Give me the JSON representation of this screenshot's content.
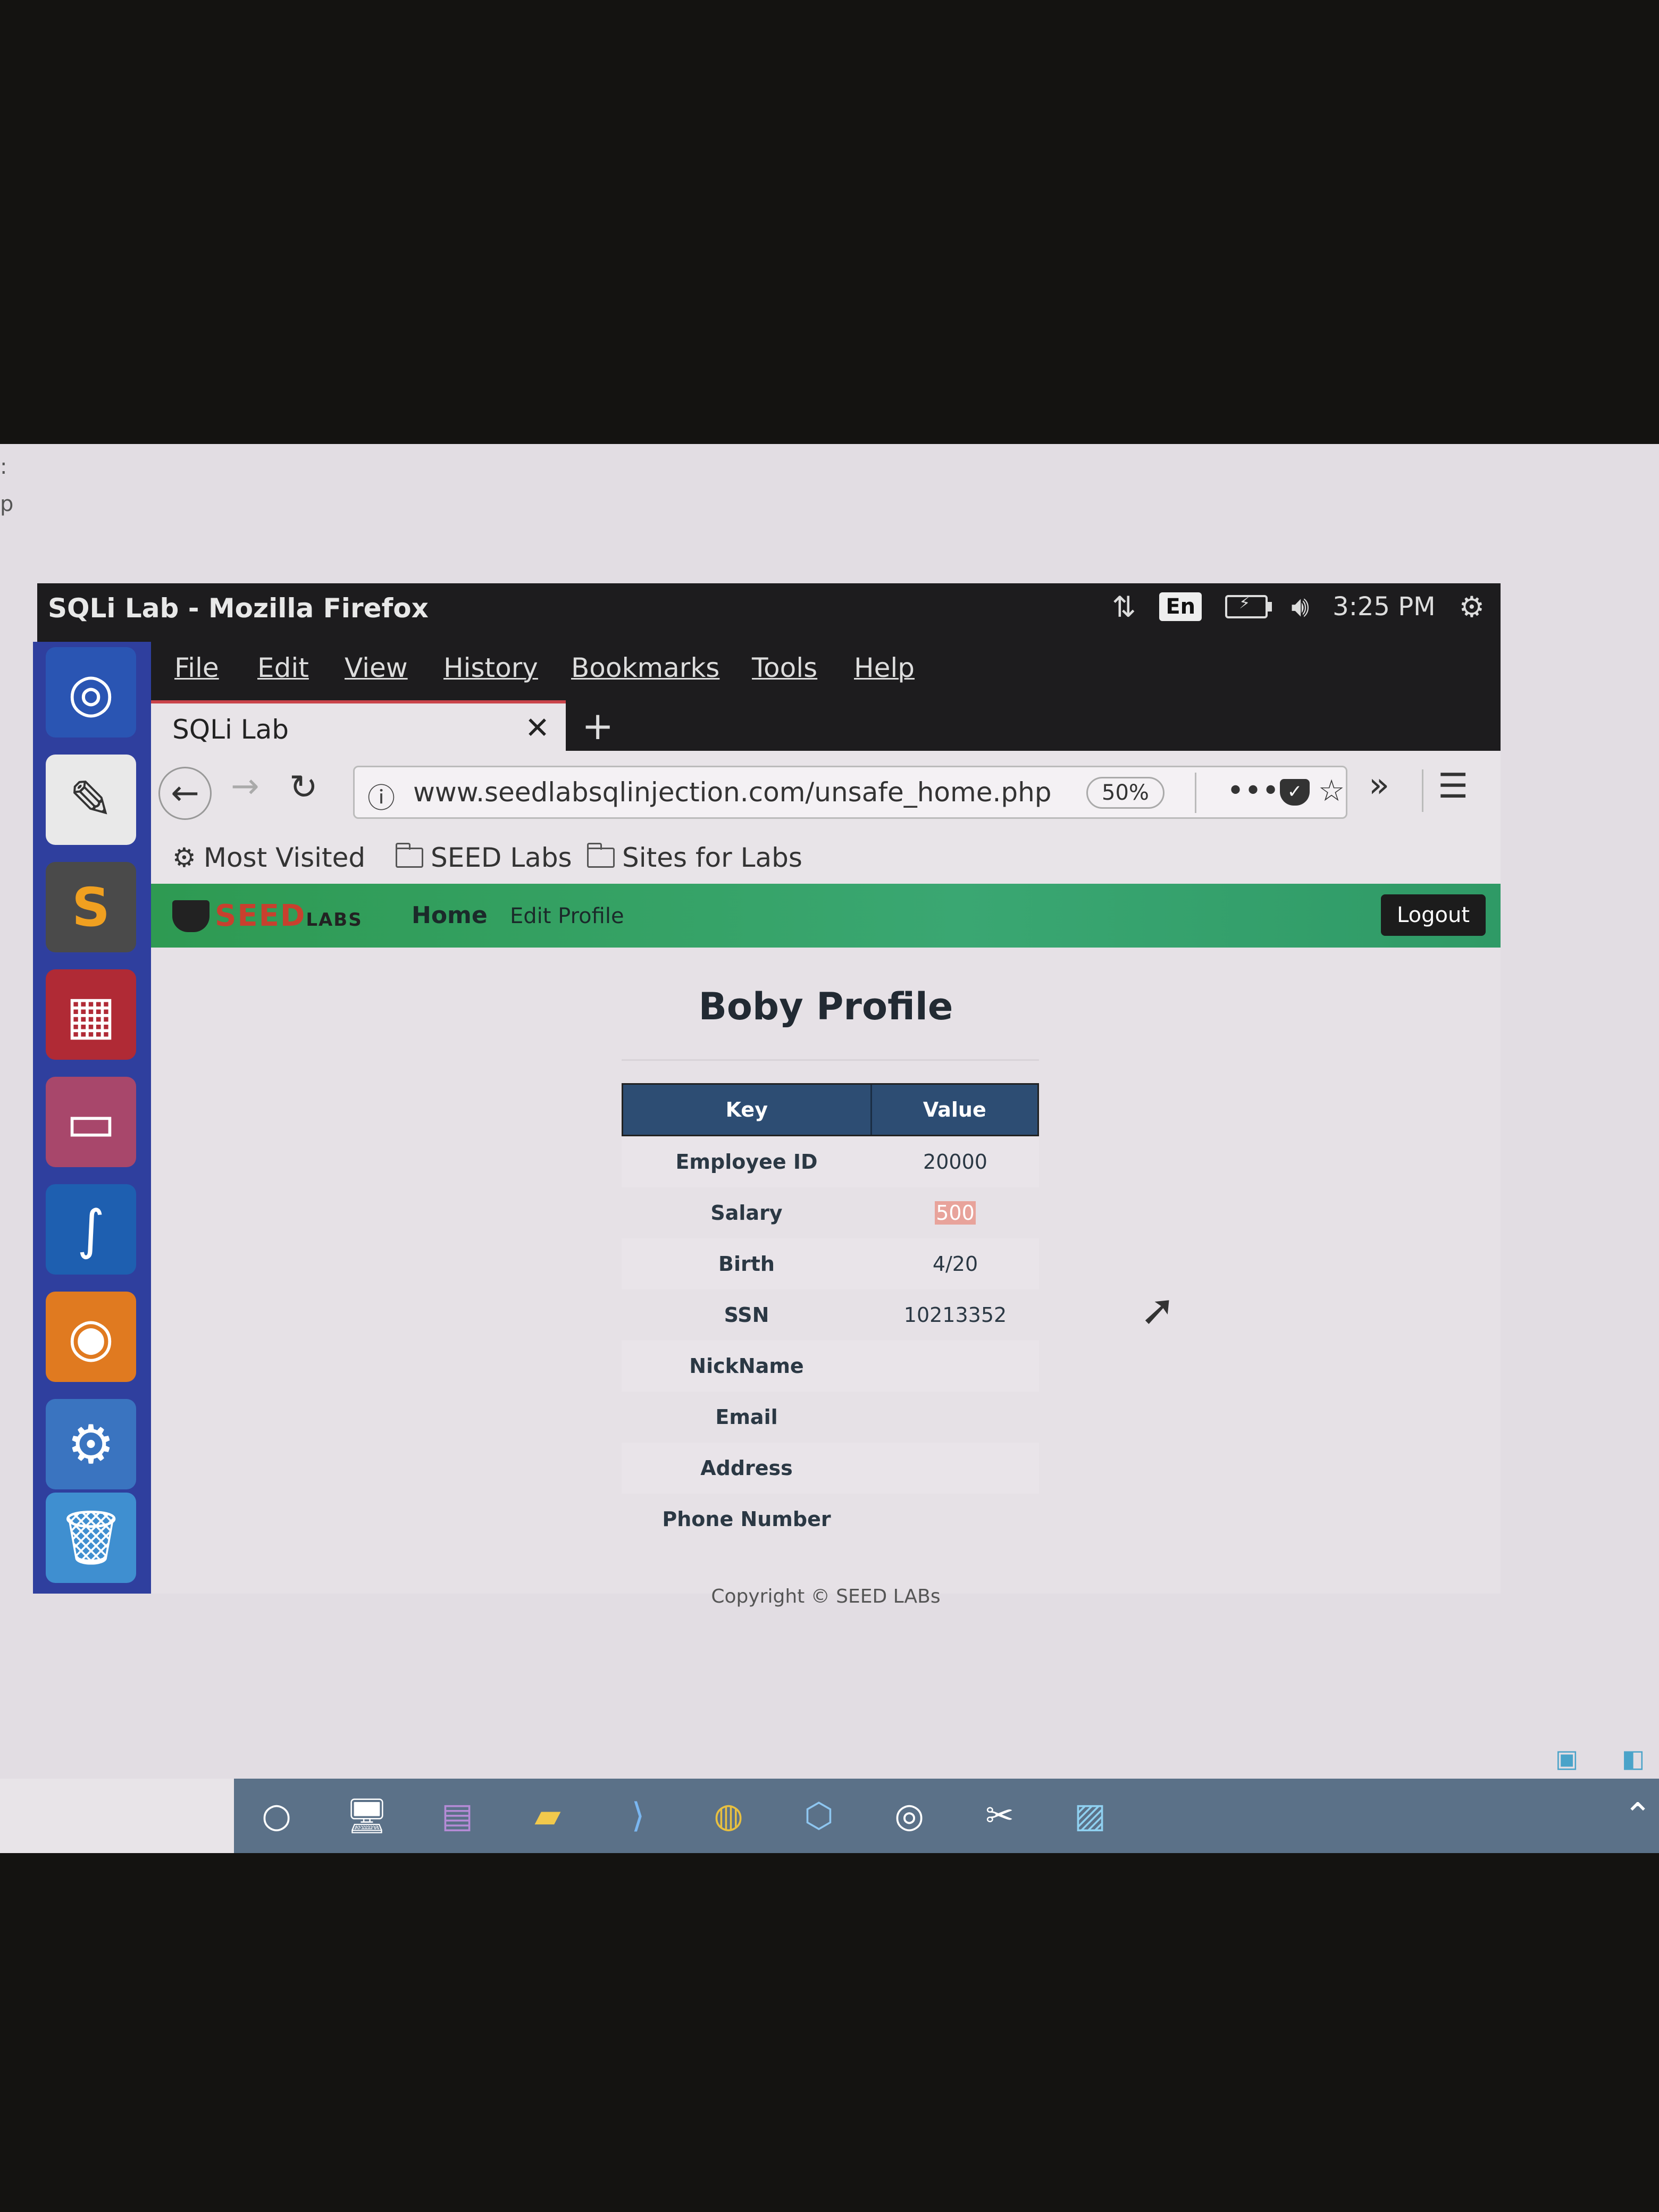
{
  "window": {
    "title": "SQLi Lab - Mozilla Firefox"
  },
  "topbar": {
    "lang": "En",
    "time": "3:25 PM"
  },
  "menu": [
    "File",
    "Edit",
    "View",
    "History",
    "Bookmarks",
    "Tools",
    "Help"
  ],
  "tab": {
    "label": "SQLi Lab"
  },
  "url": {
    "address": "www.seedlabsqlinjection.com/unsafe_home.php",
    "zoom": "50%"
  },
  "bookmarks": [
    "Most Visited",
    "SEED Labs",
    "Sites for Labs"
  ],
  "site": {
    "logo": "SEED",
    "logo_sub": "LABS",
    "nav": {
      "home": "Home",
      "edit": "Edit Profile",
      "logout": "Logout"
    }
  },
  "profile": {
    "title": "Boby Profile",
    "headers": {
      "key": "Key",
      "value": "Value"
    },
    "rows": [
      {
        "key": "Employee ID",
        "value": "20000"
      },
      {
        "key": "Salary",
        "value": "500"
      },
      {
        "key": "Birth",
        "value": "4/20"
      },
      {
        "key": "SSN",
        "value": "10213352"
      },
      {
        "key": "NickName",
        "value": ""
      },
      {
        "key": "Email",
        "value": ""
      },
      {
        "key": "Address",
        "value": ""
      },
      {
        "key": "Phone Number",
        "value": ""
      }
    ],
    "copyright": "Copyright © SEED LABs"
  },
  "colors": {
    "seed_nav": "#3aa772",
    "table_header": "#2d4d73",
    "launcher": "#2f3f9e",
    "taskbar": "#5b7188"
  }
}
